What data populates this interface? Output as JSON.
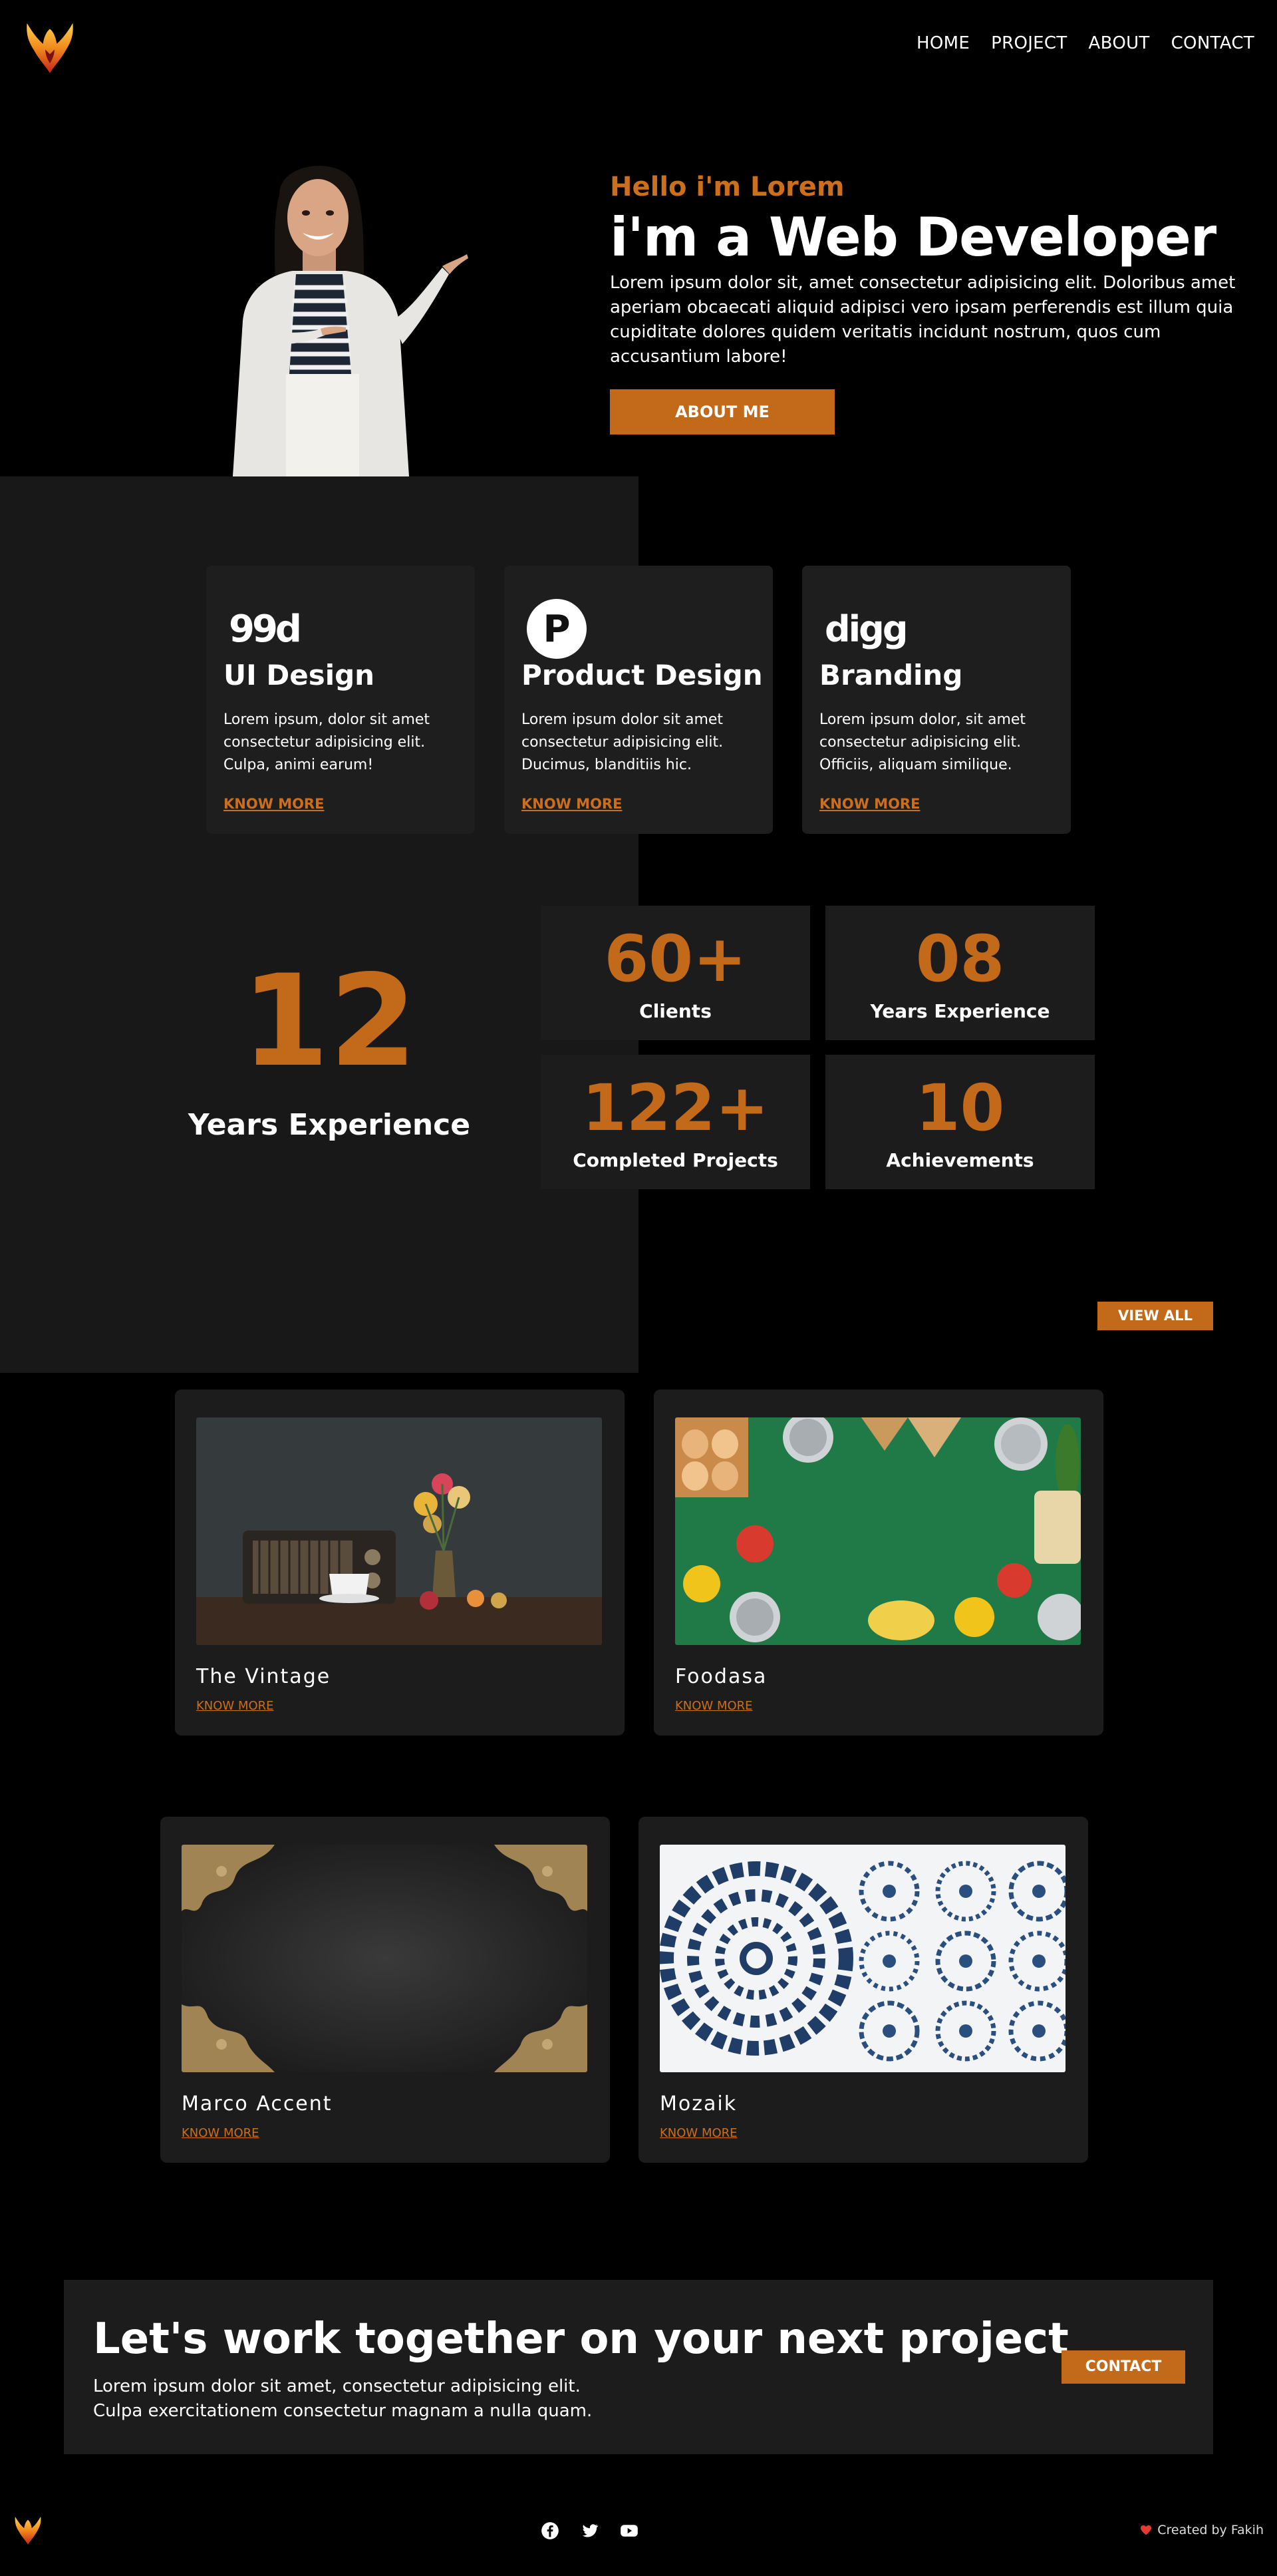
{
  "nav": {
    "items": [
      "HOME",
      "PROJECT",
      "ABOUT",
      "CONTACT"
    ]
  },
  "hero": {
    "greeting": "Hello i'm Lorem",
    "headline": "i'm a Web Developer",
    "text": "Lorem ipsum dolor sit, amet consectetur adipisicing elit. Doloribus amet aperiam obcaecati aliquid adipisci vero ipsam perferendis est illum quia cupiditate dolores quidem veritatis incidunt nostrum, quos cum accusantium labore!",
    "button": "ABOUT ME"
  },
  "services": [
    {
      "icon": "99designs-icon",
      "logo_text": "99d",
      "title": "UI Design",
      "text": "Lorem ipsum, dolor sit amet consectetur adipisicing elit. Culpa, animi earum!",
      "link": "KNOW MORE"
    },
    {
      "icon": "producthunt-icon",
      "logo_text": "P",
      "title": "Product Design",
      "text": "Lorem ipsum dolor sit amet consectetur adipisicing elit. Ducimus, blanditiis hic.",
      "link": "KNOW MORE"
    },
    {
      "icon": "digg-icon",
      "logo_text": "digg",
      "title": "Branding",
      "text": "Lorem ipsum dolor, sit amet consectetur adipisicing elit. Officiis, aliquam similique.",
      "link": "KNOW MORE"
    }
  ],
  "experience": {
    "number": "12",
    "label": "Years Experience"
  },
  "stats": [
    {
      "value": "60+",
      "label": "Clients"
    },
    {
      "value": "08",
      "label": "Years Experience"
    },
    {
      "value": "122+",
      "label": "Completed Projects"
    },
    {
      "value": "10",
      "label": "Achievements"
    }
  ],
  "portfolio": {
    "view_all": "VIEW ALL",
    "projects": [
      {
        "title": "The Vintage",
        "link": "KNOW MORE"
      },
      {
        "title": "Foodasa",
        "link": "KNOW MORE"
      },
      {
        "title": "Marco Accent",
        "link": "KNOW MORE"
      },
      {
        "title": "Mozaik",
        "link": "KNOW MORE"
      }
    ]
  },
  "cta": {
    "heading": "Let's work together on your next project",
    "line1": "Lorem ipsum dolor sit amet, consectetur adipisicing elit.",
    "line2": "Culpa exercitationem consectetur magnam a nulla quam.",
    "button": "CONTACT"
  },
  "footer": {
    "social": [
      "facebook-icon",
      "twitter-icon",
      "youtube-icon"
    ],
    "credit": "Created by Fakih"
  },
  "colors": {
    "accent": "#c2691a",
    "panel": "#181818",
    "card": "#1e1e1e",
    "background": "#000000"
  }
}
